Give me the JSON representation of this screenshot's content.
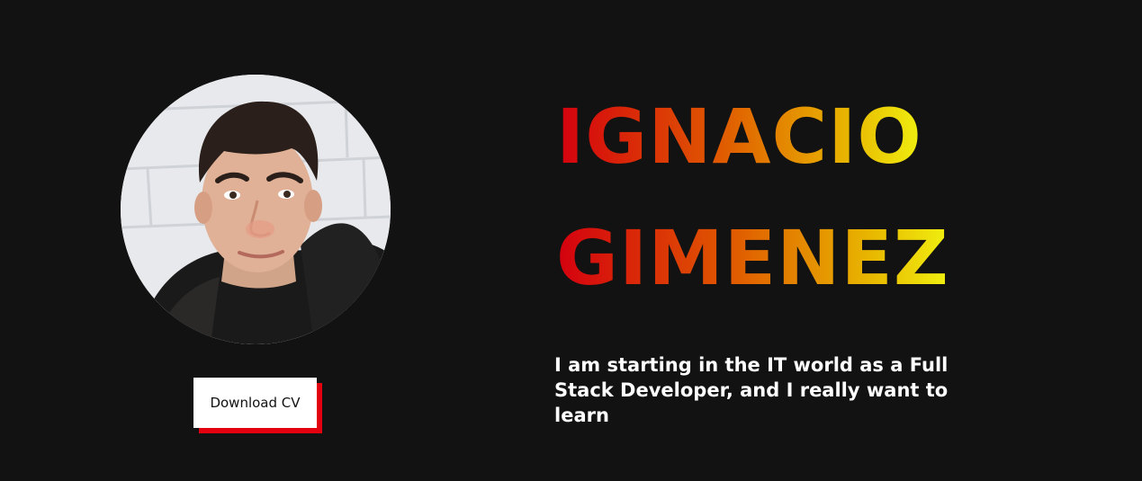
{
  "profile": {
    "photo_alt": "profile-photo",
    "first_name": "IGNACIO",
    "last_name": "GIMENEZ",
    "tagline": "I am starting in the IT world as a Full Stack Developer, and I really want to learn"
  },
  "actions": {
    "download_cv_label": "Download CV"
  },
  "colors": {
    "background": "#121212",
    "accent_red": "#e3000f",
    "gradient_start": "#d4000f",
    "gradient_end": "#f0f010",
    "text": "#ffffff"
  }
}
